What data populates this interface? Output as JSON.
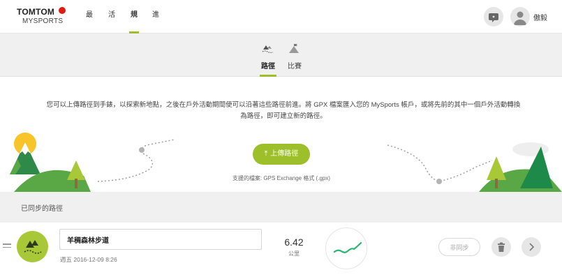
{
  "brand": {
    "logo_main": "TOMTOM",
    "logo_sub": "MYSPORTS"
  },
  "nav": {
    "items": [
      {
        "label": "最新"
      },
      {
        "label": "活動"
      },
      {
        "label": "規劃",
        "active": true
      },
      {
        "label": "進度"
      }
    ]
  },
  "user": {
    "name": "傲毅"
  },
  "subnav": {
    "tabs": [
      {
        "label": "路徑",
        "icon": "routes-icon",
        "active": true
      },
      {
        "label": "比賽",
        "icon": "race-icon",
        "active": false
      }
    ]
  },
  "intro": {
    "text": "您可以上傳路徑到手錶，以探索新地點，之後在戶外活動期間便可以沿著這些路徑前進。將 GPX 檔案匯入您的 MySports 帳戶，或將先前的其中一個戶外活動轉換為路徑，即可建立新的路徑。"
  },
  "upload": {
    "button_label": "上傳路徑",
    "formats_text": "支援的檔案: GPS Exchange 格式 (.gpx)"
  },
  "synced": {
    "title": "已同步的路徑"
  },
  "route": {
    "name": "羊稠森林步道",
    "date": "週五 2016-12-09 8:26",
    "distance": "6.42",
    "distance_unit": "公里",
    "unsync_label": "非同步"
  },
  "colors": {
    "accent": "#9cbf2a",
    "route_icon_bg": "#a9c837",
    "route_line": "#2bb673",
    "subnav_bg": "#f0f0f0"
  }
}
